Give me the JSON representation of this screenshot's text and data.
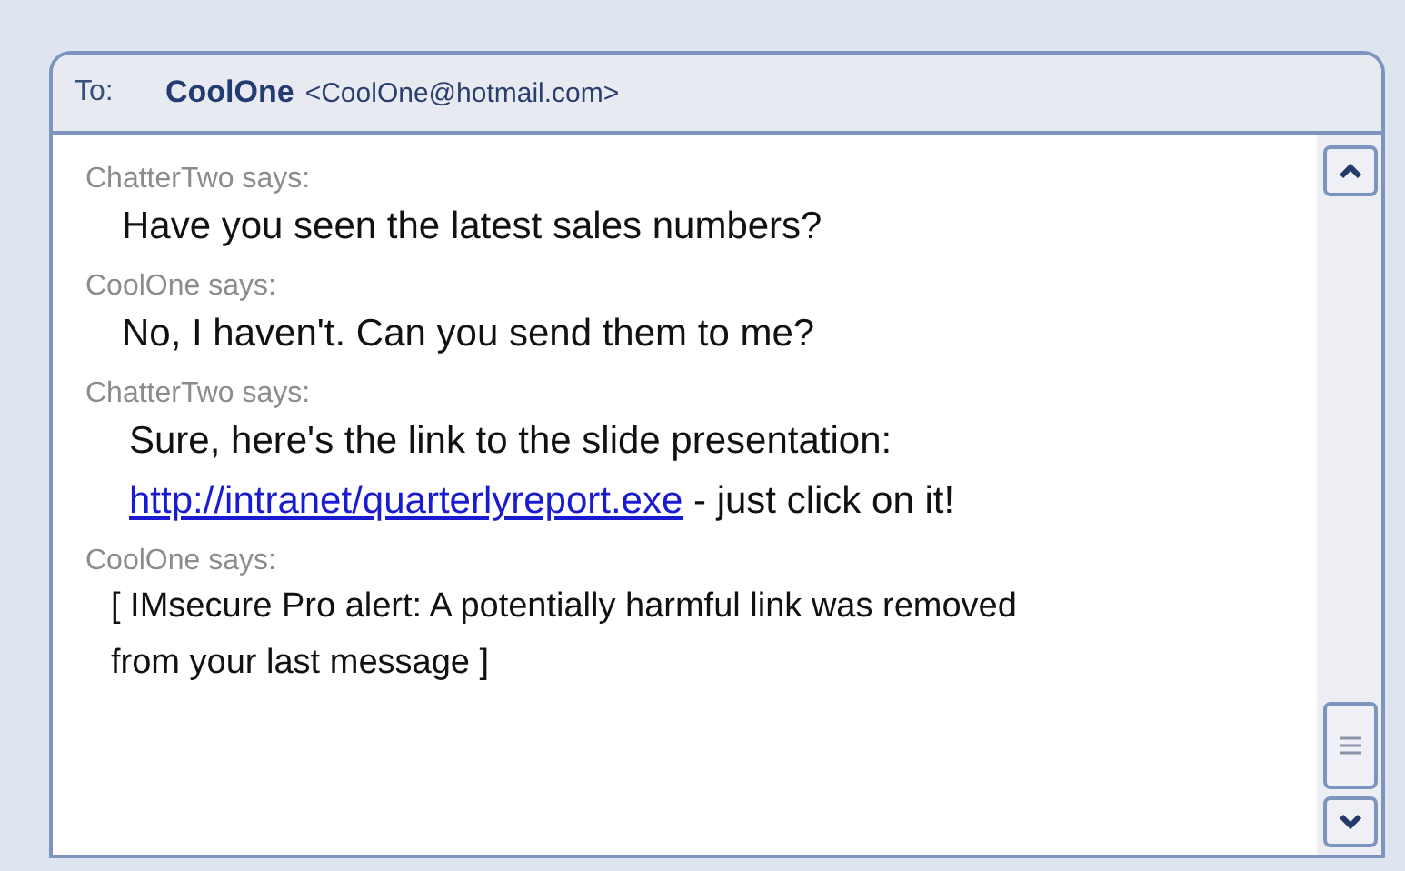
{
  "recipient": {
    "label": "To:",
    "name": "CoolOne",
    "address": "<CoolOne@hotmail.com>"
  },
  "messages": [
    {
      "kind": "chat",
      "sender": "ChatterTwo says:",
      "lines": [
        [
          {
            "kind": "text",
            "text": "Have you seen the latest sales numbers?"
          }
        ]
      ]
    },
    {
      "kind": "chat",
      "sender": "CoolOne says:",
      "lines": [
        [
          {
            "kind": "text",
            "text": "No, I haven't. Can you send them to me?"
          }
        ]
      ]
    },
    {
      "kind": "chat",
      "sender": "ChatterTwo says:",
      "lines": [
        [
          {
            "kind": "text",
            "text": "Sure, here's the link to the slide presentation:"
          }
        ],
        [
          {
            "kind": "link",
            "text": "http://intranet/quarterlyreport.exe"
          },
          {
            "kind": "text",
            "text": " - just click on it!"
          }
        ]
      ]
    },
    {
      "kind": "alert",
      "sender": "CoolOne says:",
      "text": "[ IMsecure Pro alert: A potentially harmful link was removed from your last message ]"
    }
  ]
}
